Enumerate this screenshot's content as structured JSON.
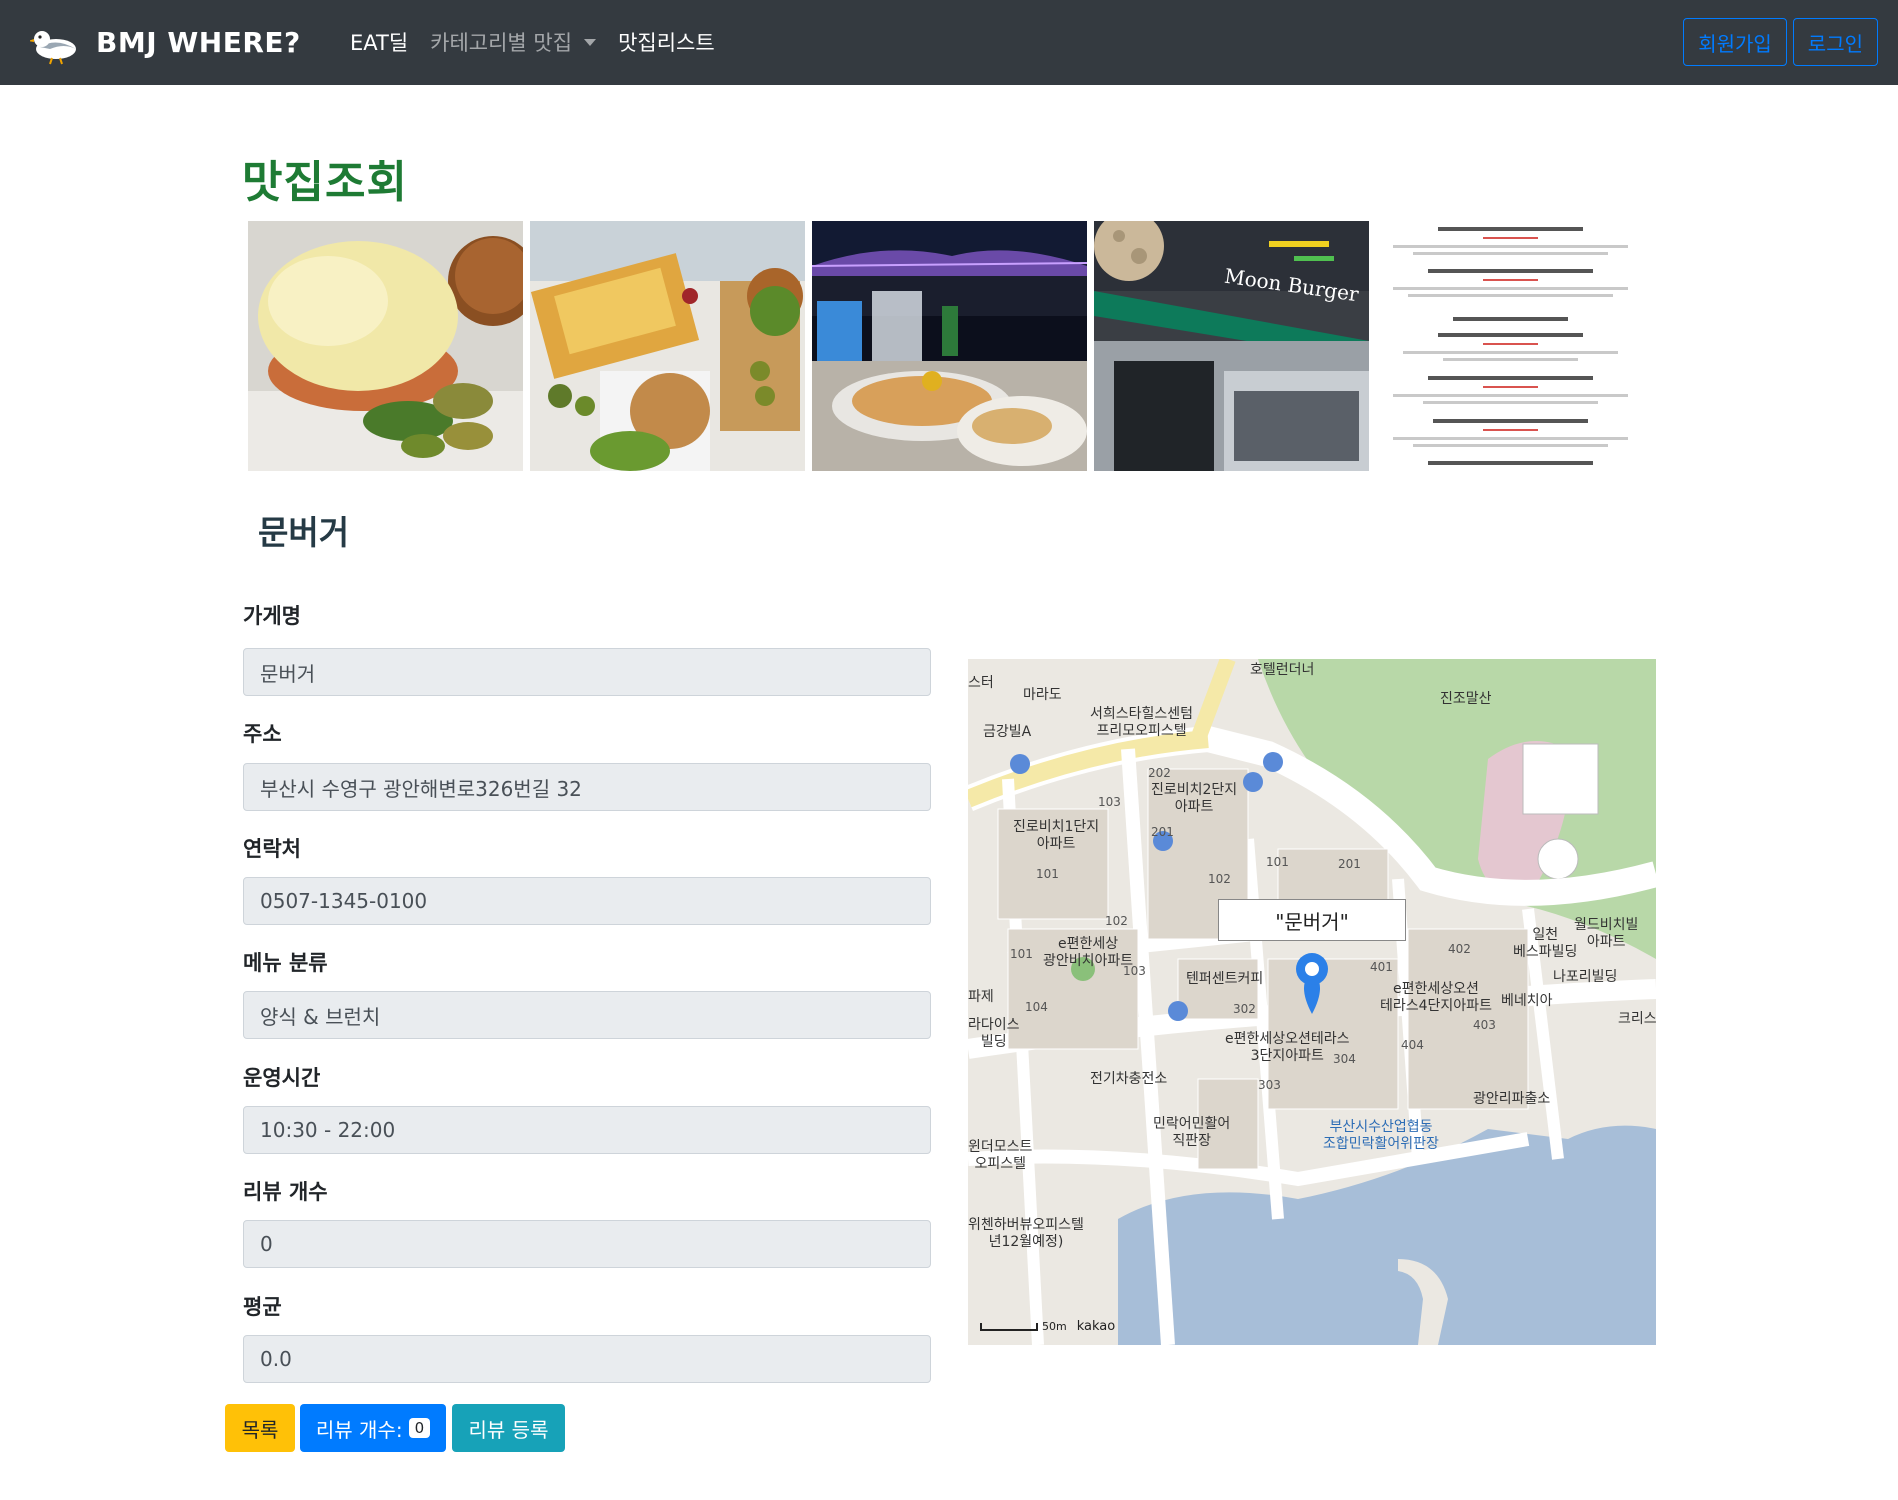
{
  "navbar": {
    "brand": "BMJ WHERE?",
    "links": [
      "EAT딜",
      "카테고리별 맛집",
      "맛집리스트"
    ],
    "signup": "회원가입",
    "login": "로그인"
  },
  "page": {
    "title": "맛집조회",
    "store_heading": "문버거"
  },
  "form": {
    "fields": [
      {
        "label": "가게명",
        "value": "문버거"
      },
      {
        "label": "주소",
        "value": "부산시 수영구 광안해변로326번길 32"
      },
      {
        "label": "연락처",
        "value": "0507-1345-0100"
      },
      {
        "label": "메뉴 분류",
        "value": "양식 & 브런치"
      },
      {
        "label": "운영시간",
        "value": "10:30 - 22:00"
      },
      {
        "label": "리뷰 개수",
        "value": "0"
      },
      {
        "label": "평균",
        "value": "0.0"
      }
    ]
  },
  "buttons": {
    "list": "목록",
    "review_count": "리뷰 개수:",
    "review_count_badge": "0",
    "register_review": "리뷰 등록"
  },
  "map": {
    "marker_label": "\"문버거\"",
    "scale": "50m",
    "provider": "kakao",
    "labels": {
      "hotel": "호텔런더너",
      "jinjo": "진조말산",
      "marado": "마라도",
      "seoul_hills": "서희스타힐스센텀\n프리모오피스텔",
      "geumgang": "금강빌A",
      "jinro2": "진로비치2단지\n아파트",
      "jinro1": "진로비치1단지\n아파트",
      "epyeon": "e편한세상\n광안비치아파트",
      "tenpercent": "텐퍼센트커피",
      "epyeon3": "e편한세상오션테라스\n3단지아파트",
      "epyeon4": "e편한세상오션\n테라스4단지아파트",
      "ilcheon": "일천\n베스파빌딩",
      "world": "월드비치빌\n아파트",
      "napoli": "나포리빌딩",
      "venezia": "베네치아",
      "charging": "전기차충전소",
      "minrak_booth": "민락어민활어\n직판장",
      "suhyup": "부산시수산업협동\n조합민락활어위판장",
      "police": "광안리파출소",
      "paradise": "라다이스\n빌딩",
      "park": "파제",
      "wedermos": "윈더모스트\n오피스텔",
      "wichen": "위첸하버뷰오피스텔\n년12월예정)",
      "star": "스터",
      "crist": "크리스"
    },
    "numbers": [
      "202",
      "103",
      "201",
      "101",
      "102",
      "101",
      "201",
      "102",
      "101",
      "103",
      "104",
      "302",
      "304",
      "303",
      "401",
      "402",
      "403",
      "404"
    ]
  }
}
